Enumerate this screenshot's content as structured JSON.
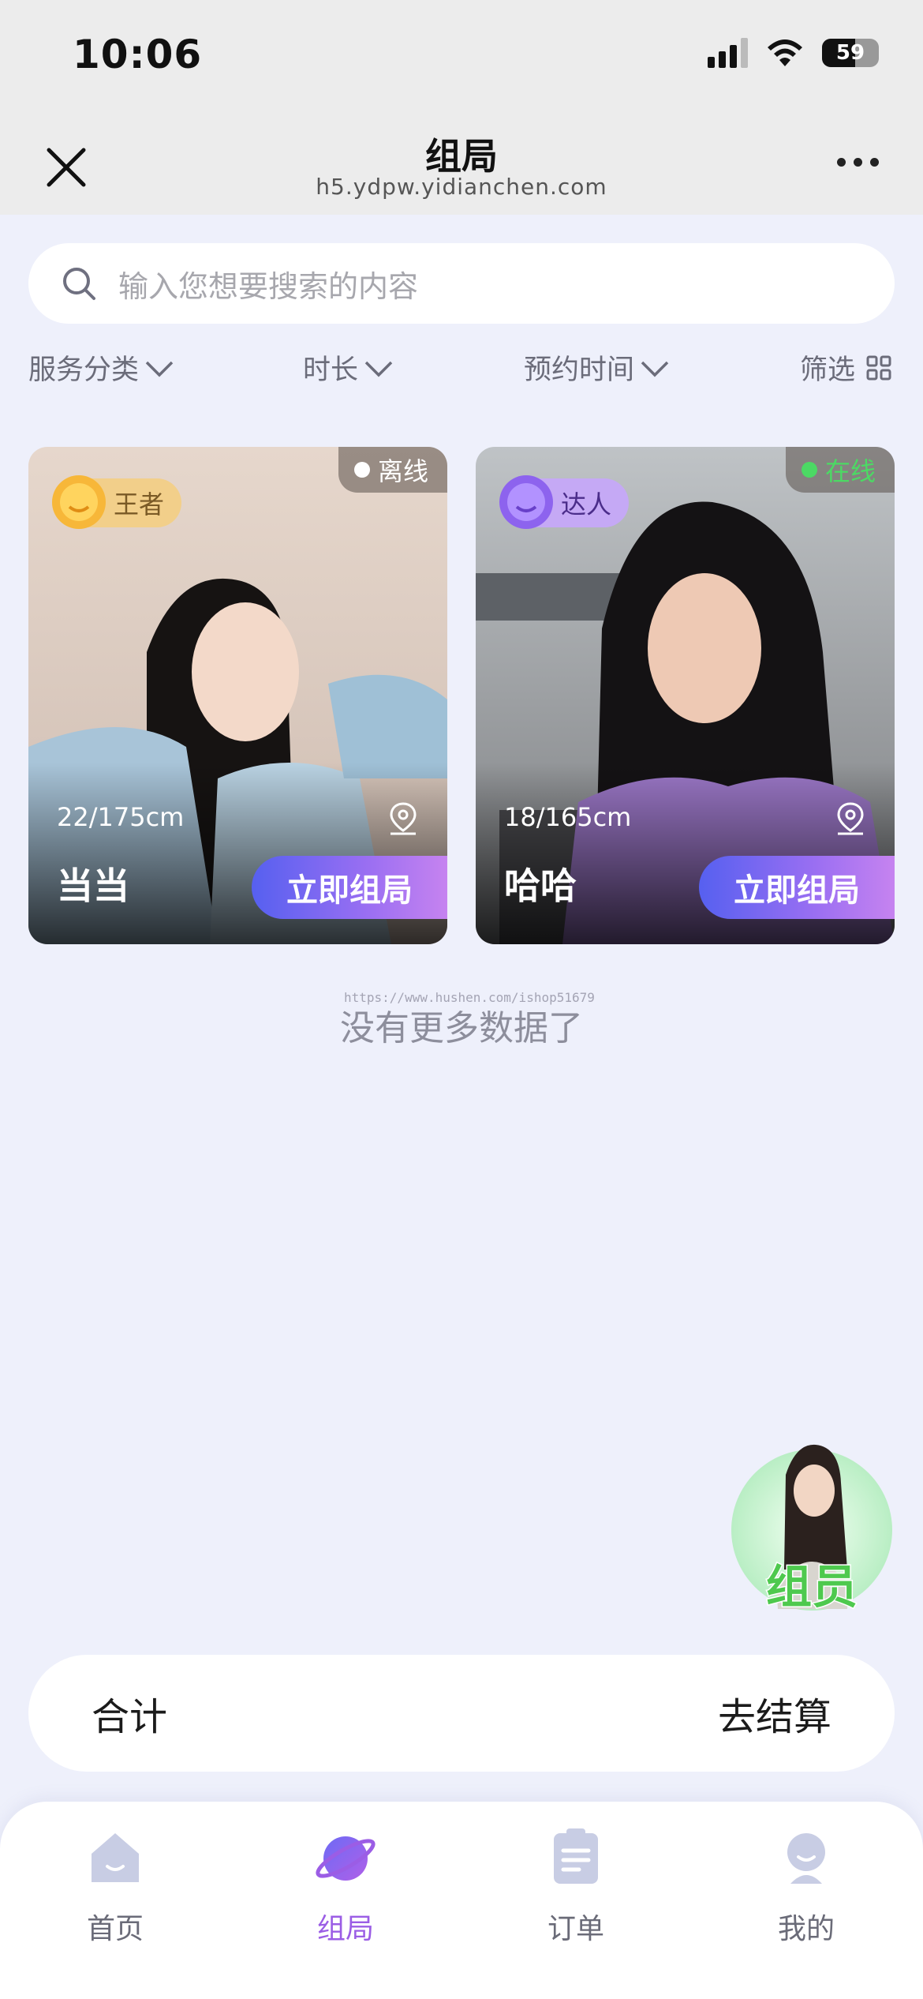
{
  "status_bar": {
    "time": "10:06",
    "battery": "59"
  },
  "nav": {
    "title": "组局",
    "subtitle": "h5.ydpw.yidianchen.com"
  },
  "search": {
    "placeholder": "输入您想要搜索的内容"
  },
  "filters": {
    "category": "服务分类",
    "duration": "时长",
    "booking_time": "预约时间",
    "screen": "筛选"
  },
  "cards": [
    {
      "status": "离线",
      "level": "王者",
      "stats": "22/175cm",
      "name": "当当",
      "action": "立即组局"
    },
    {
      "status": "在线",
      "level": "达人",
      "stats": "18/165cm",
      "name": "哈哈",
      "action": "立即组局"
    }
  ],
  "colors": {
    "online": "#4cd964",
    "offline": "#ffffff",
    "accent_purple": "#9b5de5",
    "button_start": "#5660f0",
    "button_end": "#c683f0"
  },
  "watermark": "https://www.hushen.com/ishop51679",
  "no_more_text": "没有更多数据了",
  "float_avatar_label": "组员",
  "summary": {
    "total_label": "合计",
    "checkout_label": "去结算"
  },
  "tabs": [
    {
      "label": "首页",
      "icon": "home-icon"
    },
    {
      "label": "组局",
      "icon": "planet-icon"
    },
    {
      "label": "订单",
      "icon": "clipboard-icon"
    },
    {
      "label": "我的",
      "icon": "user-icon"
    }
  ]
}
